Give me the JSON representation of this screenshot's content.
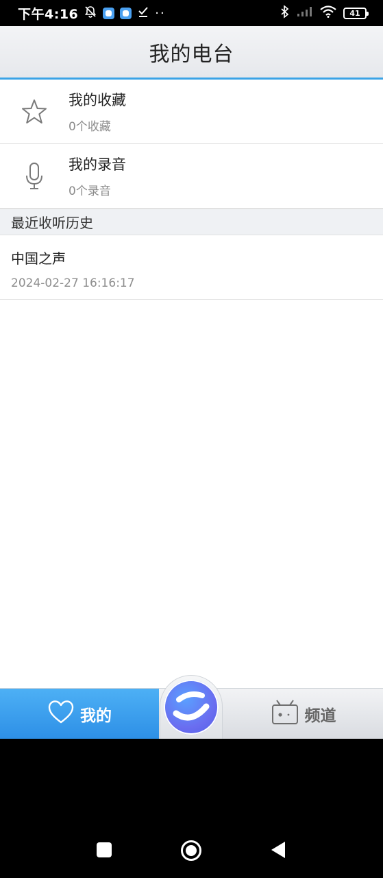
{
  "status_bar": {
    "time": "下午4:16",
    "battery": "41"
  },
  "header": {
    "title": "我的电台"
  },
  "menu": {
    "favorites": {
      "title": "我的收藏",
      "subtitle": "0个收藏"
    },
    "recordings": {
      "title": "我的录音",
      "subtitle": "0个录音"
    }
  },
  "history": {
    "section_title": "最近收听历史",
    "items": [
      {
        "title": "中国之声",
        "time": "2024-02-27 16:16:17"
      }
    ]
  },
  "tabbar": {
    "mine_label": "我的",
    "channel_label": "频道",
    "active_color": "#3ba3e6"
  },
  "icons": {
    "favorites": "star-icon",
    "recordings": "microphone-icon",
    "mine_tab": "heart-icon",
    "channel_tab": "radio-icon",
    "center": "app-logo-icon"
  }
}
